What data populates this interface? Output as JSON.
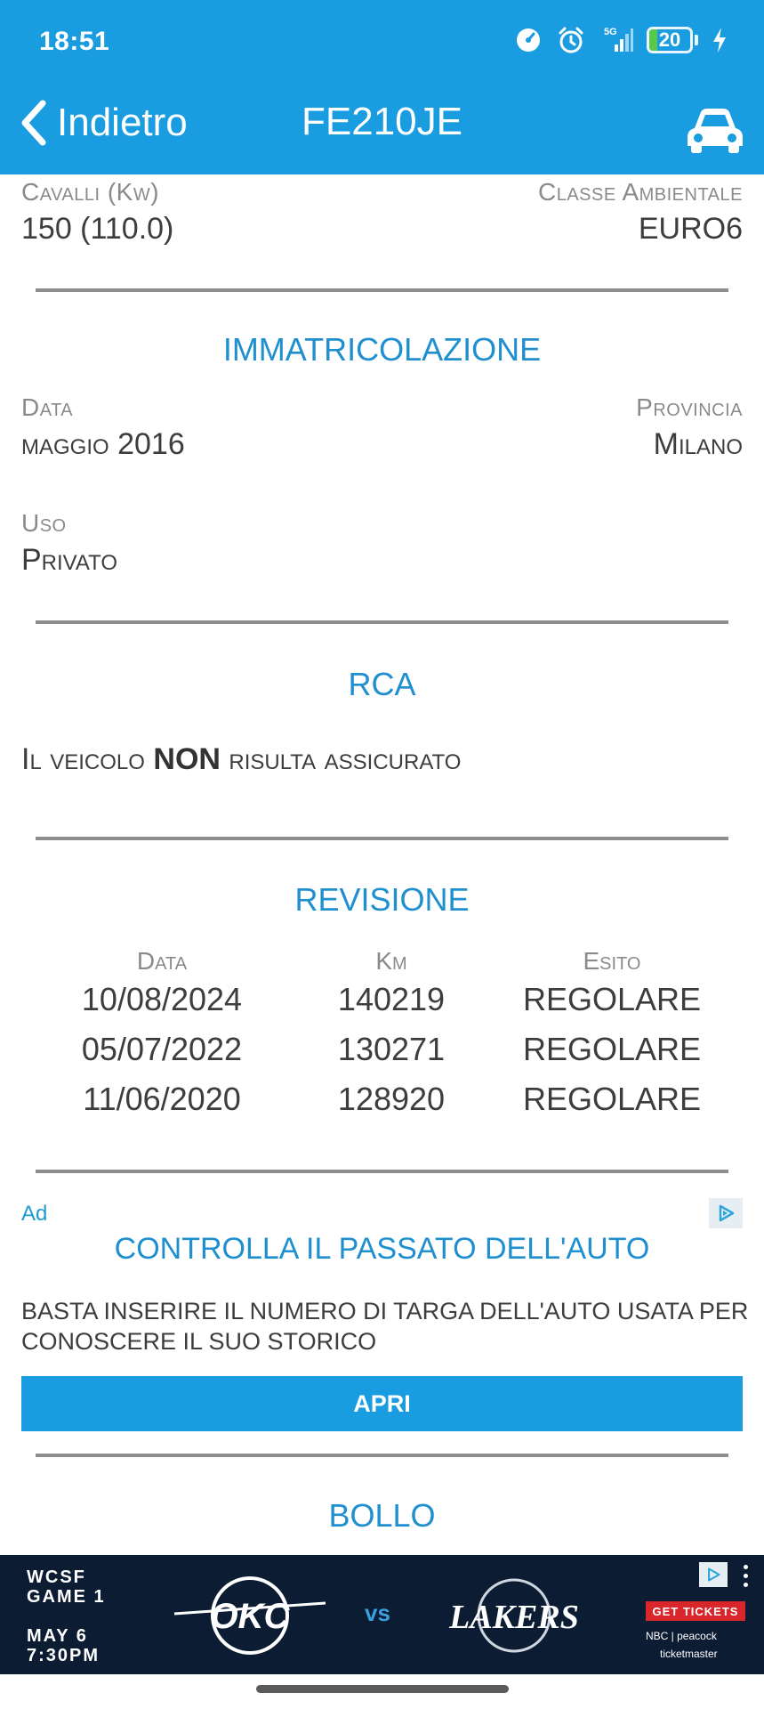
{
  "status_bar": {
    "time": "18:51",
    "network": "5G",
    "battery_level": "20",
    "battery_fraction": 0.2
  },
  "nav": {
    "back_label": "Indietro",
    "title": "FE210JE"
  },
  "engine": {
    "power_label": "Cavalli (Kw)",
    "power_value": "150 (110.0)",
    "env_class_label": "Classe Ambientale",
    "env_class_value": "EURO6"
  },
  "registration": {
    "title": "IMMATRICOLAZIONE",
    "date_label": "Data",
    "date_value": "maggio 2016",
    "province_label": "Provincia",
    "province_value": "Milano",
    "use_label": "Uso",
    "use_value": "Privato"
  },
  "insurance": {
    "title": "RCA",
    "text_before": "Il veicolo ",
    "text_strong": "NON",
    "text_after": " risulta assicurato"
  },
  "inspection": {
    "title": "REVISIONE",
    "headers": [
      "Data",
      "Km",
      "Esito"
    ],
    "rows": [
      [
        "10/08/2024",
        "140219",
        "REGOLARE"
      ],
      [
        "05/07/2022",
        "130271",
        "REGOLARE"
      ],
      [
        "11/06/2020",
        "128920",
        "REGOLARE"
      ]
    ]
  },
  "native_ad": {
    "ad_label": "Ad",
    "headline": "CONTROLLA IL PASSATO DELL'AUTO",
    "body": "BASTA INSERIRE IL NUMERO DI TARGA DELL'AUTO USATA PER CONOSCERE IL SUO STORICO",
    "button_label": "APRI"
  },
  "tax": {
    "title": "BOLLO"
  },
  "banner_ad": {
    "line1": "WCSF",
    "line2": "GAME 1",
    "line3": "MAY 6",
    "line4": "7:30PM",
    "team1": "OKC",
    "vs": "vs",
    "team2": "LAKERS",
    "cta": "GET TICKETS",
    "partners": "NBC | peacock",
    "ticketing": "ticketmaster"
  },
  "colors": {
    "primary": "#1a9ce0",
    "section_title": "#1f8fd0",
    "label_gray": "#8a8a8a",
    "divider": "#8e8e8e"
  }
}
